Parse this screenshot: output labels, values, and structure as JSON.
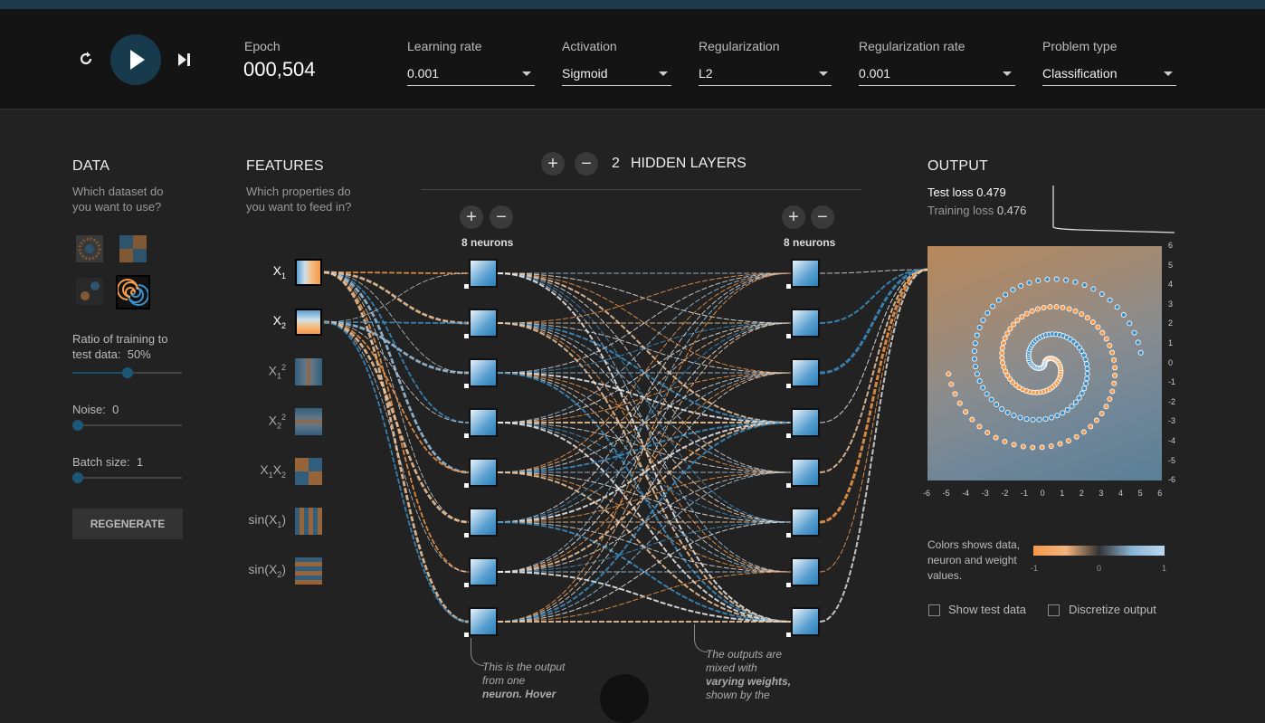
{
  "header": {
    "epoch_label": "Epoch",
    "epoch_value": "000,504",
    "controls": [
      {
        "label": "Learning rate",
        "value": "0.001"
      },
      {
        "label": "Activation",
        "value": "Sigmoid"
      },
      {
        "label": "Regularization",
        "value": "L2"
      },
      {
        "label": "Regularization rate",
        "value": "0.001"
      },
      {
        "label": "Problem type",
        "value": "Classification"
      }
    ],
    "reset_icon": "reset-icon",
    "play_icon": "play-icon",
    "step_icon": "step-forward-icon"
  },
  "data_panel": {
    "title": "DATA",
    "subtitle": "Which dataset do you want to use?",
    "ratio_label": "Ratio of training to test data:",
    "ratio_value": "50%",
    "ratio_fraction": 0.5,
    "noise_label": "Noise:",
    "noise_value": "0",
    "noise_fraction": 0,
    "batch_label": "Batch size:",
    "batch_value": "1",
    "batch_fraction": 0,
    "regenerate": "REGENERATE"
  },
  "features_panel": {
    "title": "FEATURES",
    "subtitle": "Which properties do you want to feed in?",
    "features": [
      {
        "base": "X",
        "sub": "1",
        "sup": "",
        "active": true
      },
      {
        "base": "X",
        "sub": "2",
        "sup": "",
        "active": true
      },
      {
        "base": "X",
        "sub": "1",
        "sup": "2",
        "active": false
      },
      {
        "base": "X",
        "sub": "2",
        "sup": "2",
        "active": false
      },
      {
        "base": "X",
        "sub": "1",
        "mid": "X",
        "sub2": "2",
        "active": false
      },
      {
        "base": "sin(X",
        "sub": "1",
        "tail": ")",
        "active": false
      },
      {
        "base": "sin(X",
        "sub": "2",
        "tail": ")",
        "active": false
      }
    ]
  },
  "network": {
    "count": "2",
    "hidden_layers_label": "HIDDEN LAYERS",
    "layers": [
      {
        "neurons_label": "8 neurons"
      },
      {
        "neurons_label": "8 neurons"
      }
    ],
    "annotation_1": [
      "This is the output",
      "from one",
      "neuron. Hover"
    ],
    "annotation_2": [
      "The outputs are",
      "mixed with",
      "varying weights,",
      "shown by the"
    ]
  },
  "output_panel": {
    "title": "OUTPUT",
    "test_loss_label": "Test loss",
    "test_loss_value": "0.479",
    "train_loss_label": "Training loss",
    "train_loss_value": "0.476",
    "axis_ticks": [
      "6",
      "5",
      "4",
      "3",
      "2",
      "1",
      "0",
      "-1",
      "-2",
      "-3",
      "-4",
      "-5",
      "-6"
    ],
    "x_ticks": [
      "-6",
      "-5",
      "-4",
      "-3",
      "-2",
      "-1",
      "0",
      "1",
      "2",
      "3",
      "4",
      "5",
      "6"
    ],
    "legend_text": "Colors shows data, neuron and weight values.",
    "legend_ticks": [
      "-1",
      "0",
      "1"
    ],
    "show_test_data": "Show test data",
    "discretize_output": "Discretize output",
    "colors": {
      "negative": "#f59a4a",
      "positive": "#3d8fc6"
    }
  }
}
